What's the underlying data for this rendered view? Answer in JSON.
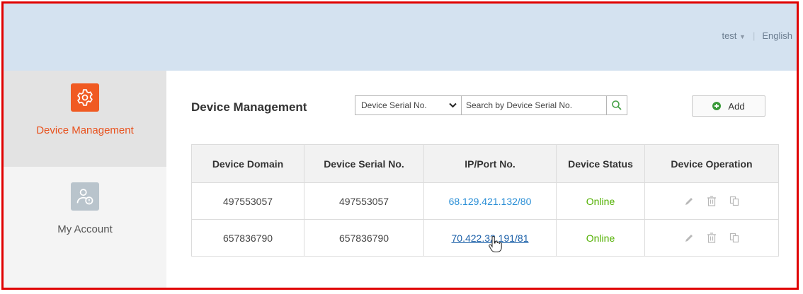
{
  "header": {
    "user": "test",
    "language": "English"
  },
  "sidebar": {
    "items": [
      {
        "label": "Device Management",
        "icon": "gear-icon",
        "active": true
      },
      {
        "label": "My Account",
        "icon": "user-account-icon",
        "active": false
      }
    ]
  },
  "main": {
    "title": "Device Management",
    "search": {
      "filter_selected": "Device Serial No.",
      "placeholder": "Search by Device Serial No."
    },
    "add_label": "Add",
    "table": {
      "columns": [
        "Device Domain",
        "Device Serial No.",
        "IP/Port No.",
        "Device Status",
        "Device Operation"
      ],
      "rows": [
        {
          "domain": "497553057",
          "serial": "497553057",
          "ip": "68.129.421.132",
          "port": "/80",
          "status": "Online"
        },
        {
          "domain": "657836790",
          "serial": "657836790",
          "ip": "70.422.32.191",
          "port": "/81",
          "status": "Online"
        }
      ]
    }
  },
  "colors": {
    "accent": "#f05a22",
    "online": "#52b000",
    "link": "#2b8fd6",
    "header_bg": "#d4e2f0",
    "frame_border": "#e00000"
  }
}
